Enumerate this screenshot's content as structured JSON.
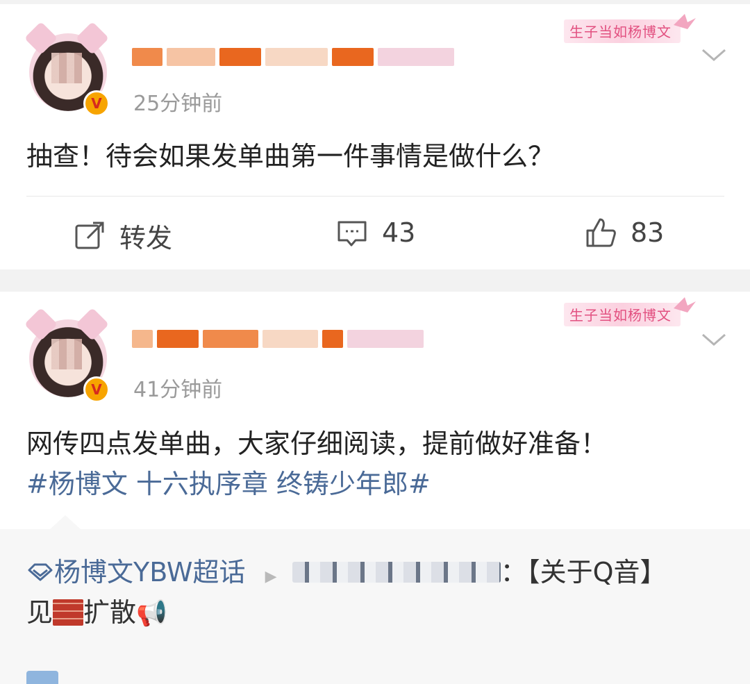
{
  "posts": [
    {
      "time": "25分钟前",
      "badge_text": "生子当如杨博文",
      "content": "抽查！待会如果发单曲第一件事情是做什么？",
      "actions": {
        "repost_label": "转发",
        "comment_count": "43",
        "like_count": "83"
      }
    },
    {
      "time": "41分钟前",
      "badge_text": "生子当如杨博文",
      "content": "网传四点发单曲，大家仔细阅读，提前做好准备！",
      "topic": "#杨博文 十六执序章 终铸少年郎#",
      "repost": {
        "super_topic": "杨博文YBW超话",
        "quote_prefix": "：【关于Q音】",
        "line2_a": "见",
        "line2_b": "扩散"
      }
    }
  ],
  "icons": {
    "repost": "share-icon",
    "comment": "comment-icon",
    "like": "thumbs-up-icon",
    "more": "chevron-down-icon",
    "verified": "verified-v-icon",
    "supertopic": "diamond-icon",
    "megaphone": "megaphone-icon",
    "brick": "brick-icon"
  },
  "colors": {
    "topic": "#4a6a97",
    "verified_badge": "#f7a400",
    "meta_gray": "#9a9a9a"
  }
}
